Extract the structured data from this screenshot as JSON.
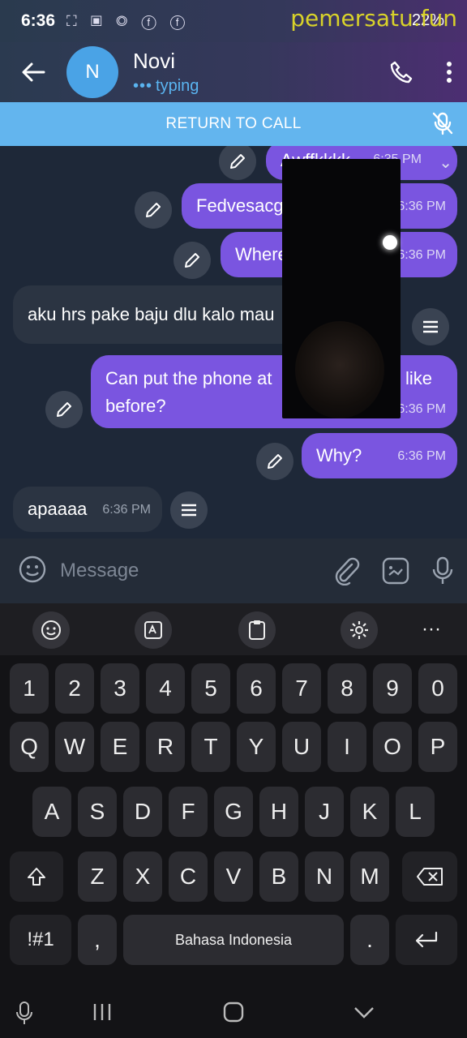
{
  "status_bar": {
    "time": "6:36",
    "icons": "⛶ ▣ ◎ ⓕ ⓕ",
    "battery": "22%"
  },
  "watermark": "pemersatu.fun",
  "header": {
    "name": "Novi",
    "avatar_letter": "N",
    "status": "typing"
  },
  "return_to_call": "RETURN TO CALL",
  "messages": [
    {
      "text": "Awffkkkk",
      "time": "6:35 PM",
      "dir": "out"
    },
    {
      "text": "Fedvesacg",
      "time": "6:36 PM",
      "dir": "out"
    },
    {
      "text": "Where",
      "time": "6:36 PM",
      "dir": "out"
    },
    {
      "text": "aku hrs pake baju dlu kalo mau",
      "time": "",
      "dir": "in"
    },
    {
      "text_line1": "Can put the phone at",
      "text_line1_tail": "like",
      "text_line2": "before?",
      "time": "6:36 PM",
      "dir": "out"
    },
    {
      "text": "Why?",
      "time": "6:36 PM",
      "dir": "out"
    },
    {
      "text": "apaaaa",
      "time": "6:36 PM",
      "dir": "in"
    }
  ],
  "composer": {
    "placeholder": "Message"
  },
  "keyboard": {
    "row_numbers": [
      "1",
      "2",
      "3",
      "4",
      "5",
      "6",
      "7",
      "8",
      "9",
      "0"
    ],
    "row1": [
      "Q",
      "W",
      "E",
      "R",
      "T",
      "Y",
      "U",
      "I",
      "O",
      "P"
    ],
    "row2": [
      "A",
      "S",
      "D",
      "F",
      "G",
      "H",
      "J",
      "K",
      "L"
    ],
    "row3": [
      "Z",
      "X",
      "C",
      "V",
      "B",
      "N",
      "M"
    ],
    "symbols": "!#1",
    "comma": ",",
    "space": "Bahasa Indonesia",
    "period": ".",
    "more": "···"
  }
}
